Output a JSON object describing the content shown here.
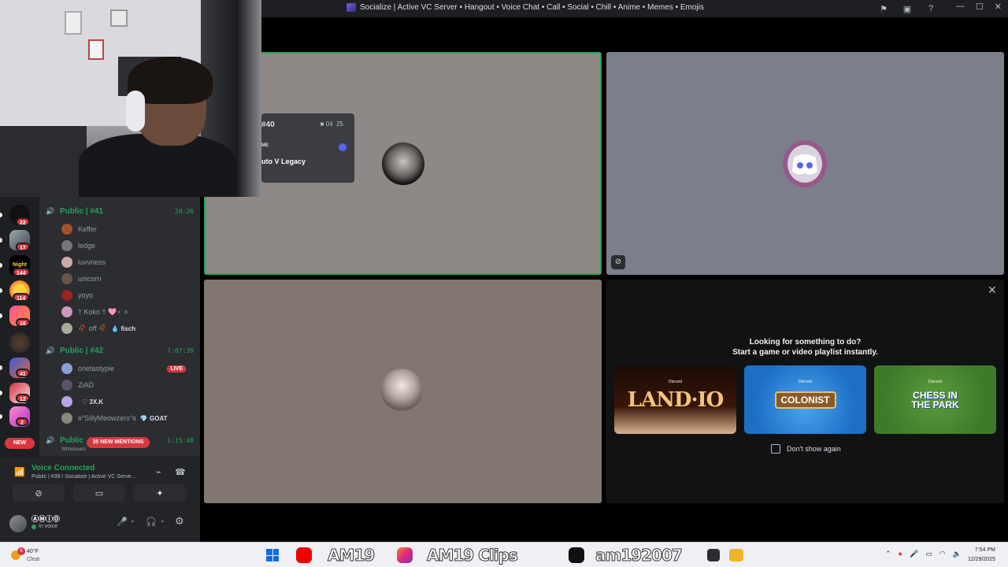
{
  "window": {
    "title": "Socialize | Active VC Server • Hangout • Voice Chat • Call • Social • Chill • Anime • Memes • Emojis"
  },
  "colors": {
    "accent_green": "#23a55a",
    "danger_red": "#da373c",
    "discord_blurple": "#5865f2"
  },
  "servers": [
    {
      "badge": "22"
    },
    {
      "badge": "17"
    },
    {
      "badge": "144",
      "label": "Night"
    },
    {
      "badge": "114"
    },
    {
      "badge": "16"
    },
    {
      "badge": ""
    },
    {
      "badge": "41"
    },
    {
      "badge": "12"
    },
    {
      "badge": "2"
    }
  ],
  "new_badge": "NEW",
  "channels": [
    {
      "name": "Public | #41",
      "time": "20:20",
      "members": [
        {
          "name": "Keffer"
        },
        {
          "name": "ledge"
        },
        {
          "name": "luvvness"
        },
        {
          "name": "unicorn"
        },
        {
          "name": "yoyo"
        },
        {
          "name": "† Koko † 🩷⋆˙⟡"
        },
        {
          "name": "🥀 off 🥀",
          "tag": "💧 fisch"
        }
      ]
    },
    {
      "name": "Public | #42",
      "time": "7:07:39",
      "members": [
        {
          "name": "onetastypie",
          "live": "LIVE"
        },
        {
          "name": "ZiAD"
        },
        {
          "name": "",
          "tag": "♡ 3X.K"
        },
        {
          "name": "ʚ°SillyMeowzers°ɞ",
          "tag": "💎 GOAT"
        }
      ]
    },
    {
      "name": "Public",
      "time": "1:15:48",
      "sub": "Whiteboard"
    }
  ],
  "mentions_pill": "35 NEW MENTIONS",
  "voice": {
    "status": "Voice Connected",
    "channel": "Public | #39 / Socialize | Active VC Serve..."
  },
  "user": {
    "name": "ⒶⓂⒾⓄ",
    "status": "In voice"
  },
  "stream_popup": {
    "number": "#40",
    "cam_count": "04",
    "cam_total": "25",
    "label": "ME",
    "game": "uto V Legacy"
  },
  "activity": {
    "heading": "Looking for something to do?",
    "subheading": "Start a game or video playlist instantly.",
    "cards": [
      {
        "brand": "Discord",
        "title": "LAND·IO"
      },
      {
        "brand": "Discord",
        "title": "COLONIST"
      },
      {
        "brand": "Discord",
        "title": "CHESS IN THE PARK"
      }
    ],
    "dont_show": "Don't show again"
  },
  "taskbar": {
    "weather_badge": "6",
    "temp": "40°F",
    "condition": "Clear",
    "overlay_1": "AM19",
    "overlay_2": "AM19 Clips",
    "overlay_3": "am192007",
    "time": "7:54 PM",
    "date": "12/29/2025"
  }
}
